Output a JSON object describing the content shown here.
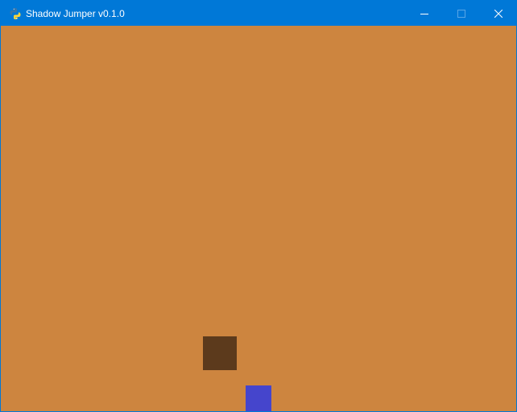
{
  "window": {
    "title": "Shadow Jumper v0.1.0",
    "app_icon": "python-icon",
    "controls": {
      "minimize_icon": "minimize-icon",
      "maximize_icon": "maximize-icon",
      "close_icon": "close-icon"
    }
  },
  "colors": {
    "titlebar": "#0078d7",
    "background": "#cd853f",
    "shadow_block": "#5c3a1c",
    "player": "#4545cc"
  }
}
